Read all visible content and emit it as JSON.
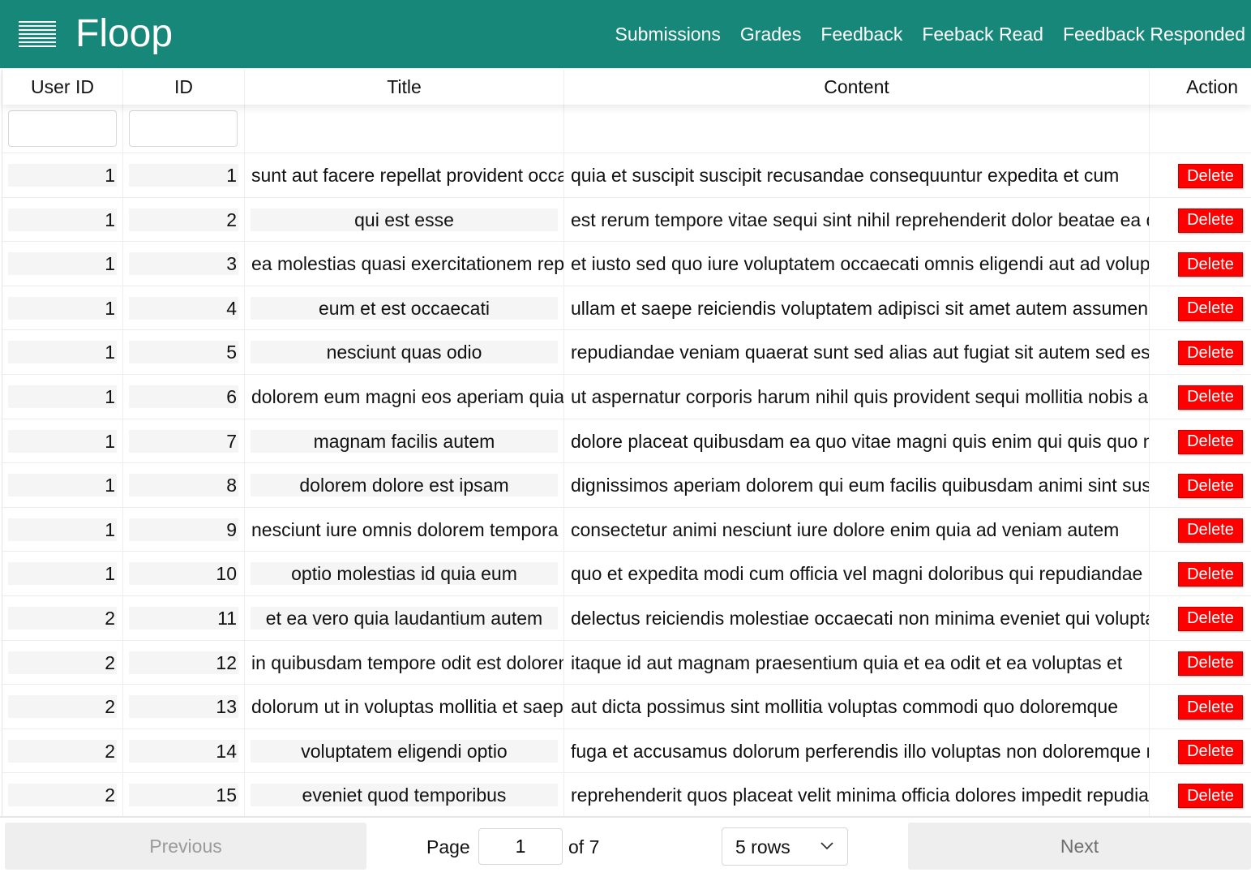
{
  "header": {
    "brand": "Floop",
    "nav": [
      "Submissions",
      "Grades",
      "Feedback",
      "Feeback Read",
      "Feedback Responded"
    ]
  },
  "table": {
    "columns": [
      "User ID",
      "ID",
      "Title",
      "Content",
      "Action"
    ],
    "filters": {
      "user_id": "",
      "id": ""
    },
    "rows": [
      {
        "user_id": "1",
        "id": "1",
        "title": "sunt aut facere repellat provident occaecati excepturi optio reprehenderit",
        "content": "quia et suscipit suscipit recusandae consequuntur expedita et cum",
        "action": "Delete"
      },
      {
        "user_id": "1",
        "id": "2",
        "title": "qui est esse",
        "content": "est rerum tempore vitae sequi sint nihil reprehenderit dolor beatae ea dolores neque",
        "action": "Delete"
      },
      {
        "user_id": "1",
        "id": "3",
        "title": "ea molestias quasi exercitationem repellat qui ipsa sit aut",
        "content": "et iusto sed quo iure voluptatem occaecati omnis eligendi aut ad voluptatem doloribus",
        "action": "Delete"
      },
      {
        "user_id": "1",
        "id": "4",
        "title": "eum et est occaecati",
        "content": "ullam et saepe reiciendis voluptatem adipisci sit amet autem assumenda provident",
        "action": "Delete"
      },
      {
        "user_id": "1",
        "id": "5",
        "title": "nesciunt quas odio",
        "content": "repudiandae veniam quaerat sunt sed alias aut fugiat sit autem sed est",
        "action": "Delete"
      },
      {
        "user_id": "1",
        "id": "6",
        "title": "dolorem eum magni eos aperiam quia",
        "content": "ut aspernatur corporis harum nihil quis provident sequi mollitia nobis aliquid",
        "action": "Delete"
      },
      {
        "user_id": "1",
        "id": "7",
        "title": "magnam facilis autem",
        "content": "dolore placeat quibusdam ea quo vitae magni quis enim qui quis quo nemo",
        "action": "Delete"
      },
      {
        "user_id": "1",
        "id": "8",
        "title": "dolorem dolore est ipsam",
        "content": "dignissimos aperiam dolorem qui eum facilis quibusdam animi sint suscipit",
        "action": "Delete"
      },
      {
        "user_id": "1",
        "id": "9",
        "title": "nesciunt iure omnis dolorem tempora et accusantium",
        "content": "consectetur animi nesciunt iure dolore enim quia ad veniam autem",
        "action": "Delete"
      },
      {
        "user_id": "1",
        "id": "10",
        "title": "optio molestias id quia eum",
        "content": "quo et expedita modi cum officia vel magni doloribus qui repudiandae",
        "action": "Delete"
      },
      {
        "user_id": "2",
        "id": "11",
        "title": "et ea vero quia laudantium autem",
        "content": "delectus reiciendis molestiae occaecati non minima eveniet qui voluptatibus",
        "action": "Delete"
      },
      {
        "user_id": "2",
        "id": "12",
        "title": "in quibusdam tempore odit est dolorem",
        "content": "itaque id aut magnam praesentium quia et ea odit et ea voluptas et",
        "action": "Delete"
      },
      {
        "user_id": "2",
        "id": "13",
        "title": "dolorum ut in voluptas mollitia et saepe quo animi",
        "content": "aut dicta possimus sint mollitia voluptas commodi quo doloremque",
        "action": "Delete"
      },
      {
        "user_id": "2",
        "id": "14",
        "title": "voluptatem eligendi optio",
        "content": "fuga et accusamus dolorum perferendis illo voluptas non doloremque neque",
        "action": "Delete"
      },
      {
        "user_id": "2",
        "id": "15",
        "title": "eveniet quod temporibus",
        "content": "reprehenderit quos placeat velit minima officia dolores impedit repudiandae",
        "action": "Delete"
      }
    ]
  },
  "pagination": {
    "previous": "Previous",
    "next": "Next",
    "page_label": "Page",
    "page": "1",
    "of_label": "of 7",
    "rows_option": "5 rows"
  }
}
